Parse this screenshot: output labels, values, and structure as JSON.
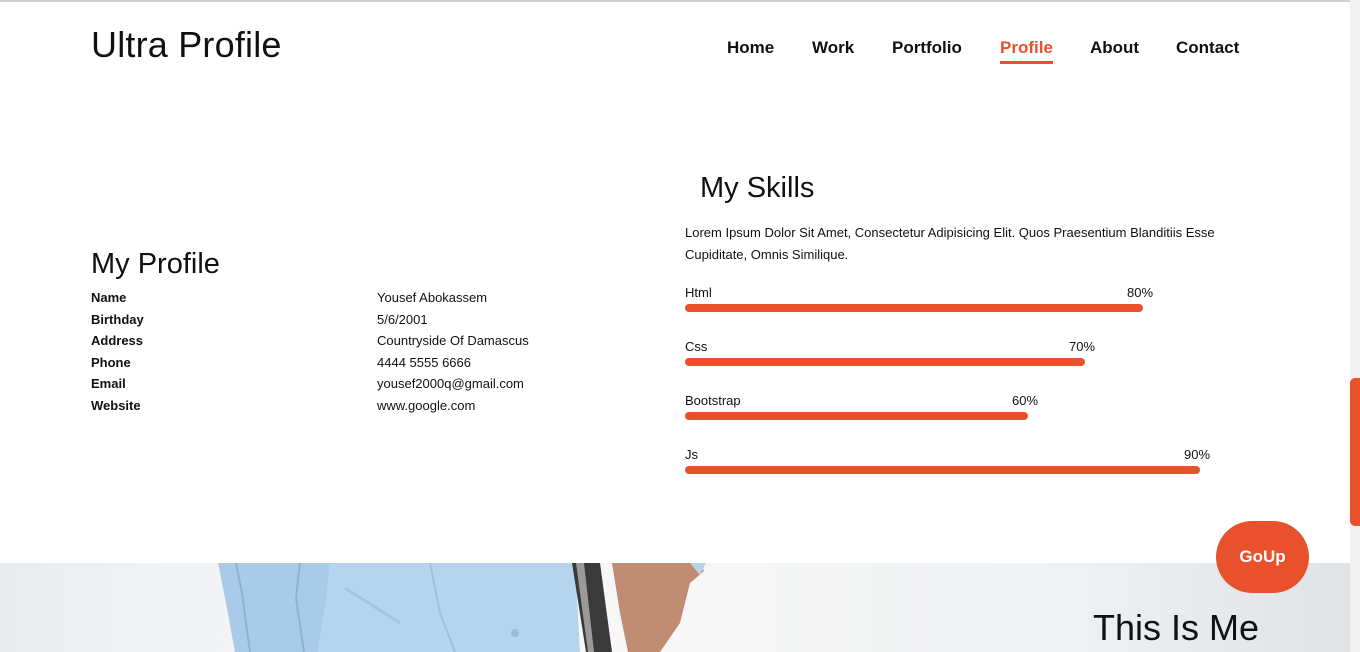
{
  "header": {
    "logo": "Ultra Profile",
    "nav": [
      {
        "label": "Home",
        "active": false
      },
      {
        "label": "Work",
        "active": false
      },
      {
        "label": "Portfolio",
        "active": false
      },
      {
        "label": "Profile",
        "active": true
      },
      {
        "label": "About",
        "active": false
      },
      {
        "label": "Contact",
        "active": false
      }
    ]
  },
  "profile": {
    "title": "My Profile",
    "rows": [
      {
        "key": "Name",
        "value": "Yousef Abokassem"
      },
      {
        "key": "Birthday",
        "value": "5/6/2001"
      },
      {
        "key": "Address",
        "value": "Countryside Of Damascus"
      },
      {
        "key": "Phone",
        "value": "4444 5555 6666"
      },
      {
        "key": "Email",
        "value": "yousef2000q@gmail.com"
      },
      {
        "key": "Website",
        "value": "www.google.com"
      }
    ]
  },
  "skills": {
    "title": "My Skills",
    "description": "Lorem Ipsum Dolor Sit Amet, Consectetur Adipisicing Elit. Quos Praesentium Blanditiis Esse Cupiditate, Omnis Similique.",
    "items": [
      {
        "name": "Html",
        "percent_label": "80%",
        "percent": 80
      },
      {
        "name": "Css",
        "percent_label": "70%",
        "percent": 70
      },
      {
        "name": "Bootstrap",
        "percent_label": "60%",
        "percent": 60
      },
      {
        "name": "Js",
        "percent_label": "90%",
        "percent": 90
      }
    ]
  },
  "goup": {
    "label": "GoUp"
  },
  "hero": {
    "title": "This Is Me"
  },
  "colors": {
    "accent": "#e8512b"
  }
}
